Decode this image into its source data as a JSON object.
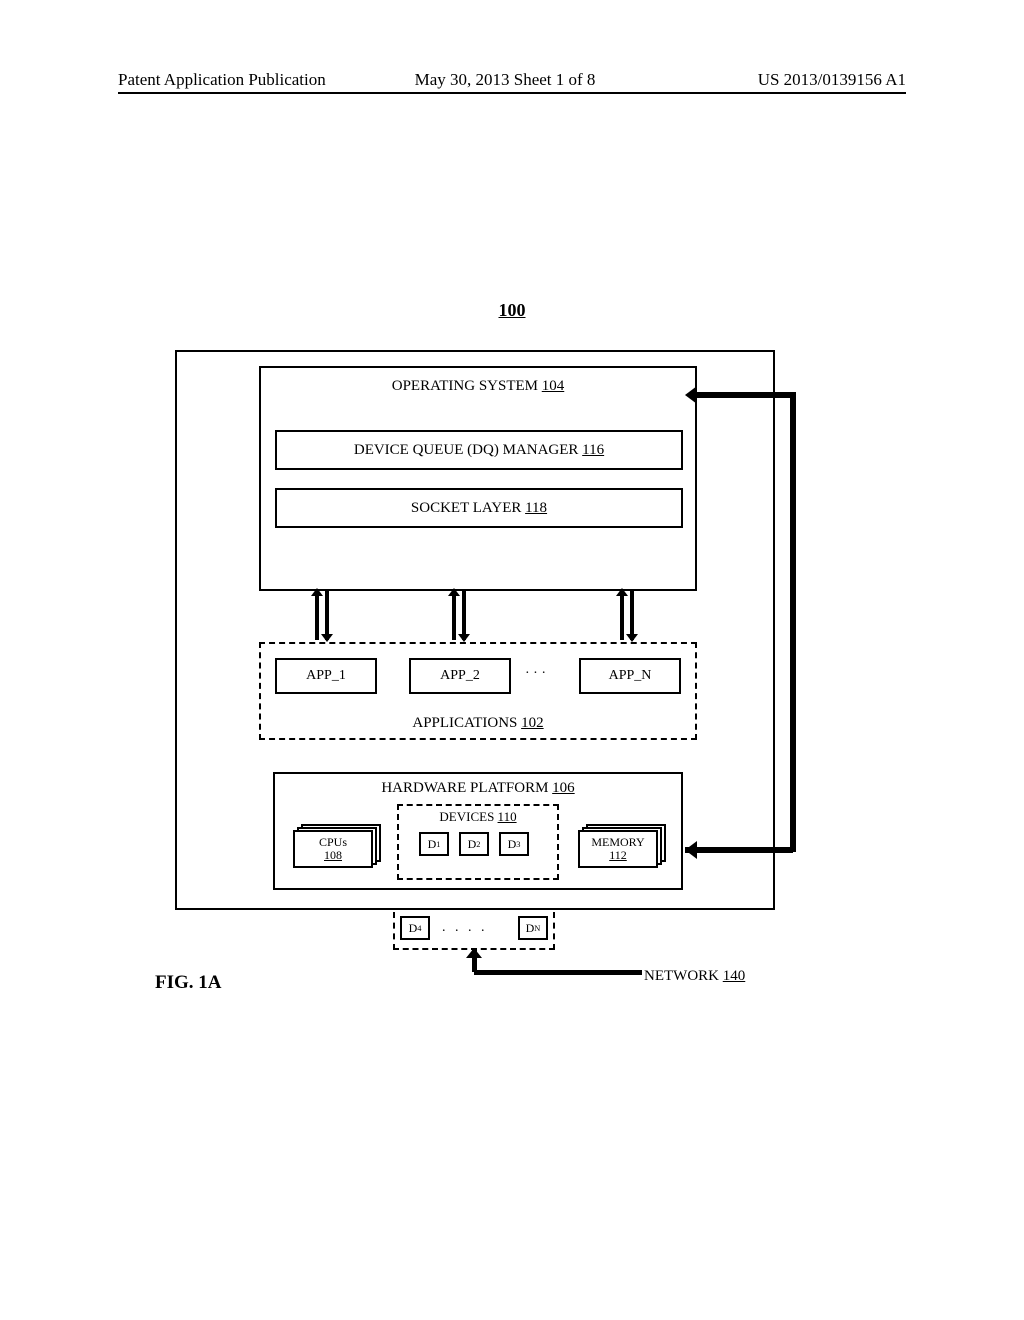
{
  "header": {
    "left": "Patent Application Publication",
    "center": "May 30, 2013  Sheet 1 of 8",
    "right": "US 2013/0139156 A1"
  },
  "figure": {
    "number": "100",
    "label": "FIG. 1A"
  },
  "os": {
    "title_text": "OPERATING SYSTEM",
    "title_ref": "104",
    "dq_text": "DEVICE QUEUE (DQ) MANAGER",
    "dq_ref": "116",
    "socket_text": "SOCKET LAYER",
    "socket_ref": "118"
  },
  "apps": {
    "label_text": "APPLICATIONS",
    "label_ref": "102",
    "app1": "APP_1",
    "app2": "APP_2",
    "appn": "APP_N",
    "dots": "· · ·"
  },
  "hardware": {
    "title_text": "HARDWARE PLATFORM",
    "title_ref": "106",
    "cpus_text": "CPUs",
    "cpus_ref": "108",
    "memory_text": "MEMORY",
    "memory_ref": "112",
    "devices_text": "DEVICES",
    "devices_ref": "110",
    "d1": "D",
    "d1_sub": "1",
    "d2": "D",
    "d2_sub": "2",
    "d3": "D",
    "d3_sub": "3",
    "d4": "D",
    "d4_sub": "4",
    "dn": "D",
    "dn_sub": "N",
    "d_dots": ". . . ."
  },
  "network": {
    "text": "NETWORK",
    "ref": "140"
  }
}
